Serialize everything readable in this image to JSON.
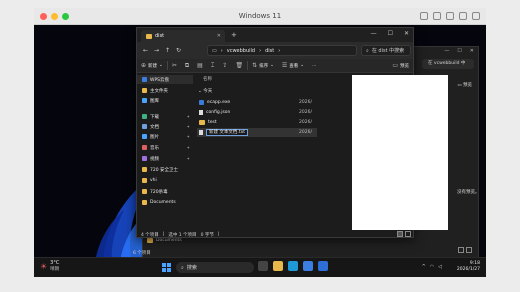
{
  "host": {
    "title": "Windows 11"
  },
  "bg_window": {
    "search_placeholder": "在 vcwebbuild 中",
    "preview_label": "预览",
    "message": "没有预览。",
    "nav_documents": "Documents",
    "status_count": "6 个项目"
  },
  "window": {
    "tab_title": "dist",
    "breadcrumb": [
      "vcwebbuild",
      "dist"
    ],
    "search_placeholder": "在 dist 中搜索",
    "cmd_new": "新建",
    "cmd_sort": "排序",
    "cmd_view": "查看",
    "cmd_more": "...",
    "cmd_preview": "预览"
  },
  "nav": {
    "items": [
      {
        "label": "WPS云盘",
        "color": "#3b7de0"
      },
      {
        "label": "主文件夹",
        "color": "#e8b84a"
      },
      {
        "label": "图库",
        "color": "#4aa3ff"
      },
      {
        "label": "下载",
        "color": "#3fb07f",
        "pinned": true
      },
      {
        "label": "文档",
        "color": "#6fa0e0",
        "pinned": true
      },
      {
        "label": "图片",
        "color": "#4aa3ff",
        "pinned": true
      },
      {
        "label": "音乐",
        "color": "#e06060",
        "pinned": true
      },
      {
        "label": "视频",
        "color": "#a070e0",
        "pinned": true
      },
      {
        "label": "720 安全卫士",
        "color": "#e8b84a"
      },
      {
        "label": "vhi",
        "color": "#e8b84a"
      },
      {
        "label": "720杀毒",
        "color": "#e8b84a"
      },
      {
        "label": "Documents",
        "color": "#e8b84a"
      }
    ]
  },
  "files": {
    "col_name": "名称",
    "col_date": "修改日期",
    "group_today": "今天",
    "rows": [
      {
        "name": "ecapp.exe",
        "date": "2026/",
        "icon": "exe"
      },
      {
        "name": "config.json",
        "date": "2026/",
        "icon": "doc"
      },
      {
        "name": "test",
        "date": "2026/",
        "icon": "folder"
      },
      {
        "name": "新建 文本文档.txt",
        "date": "2026/",
        "icon": "doc",
        "renaming": true
      }
    ]
  },
  "status": {
    "count": "4 个项目",
    "selection": "选中 1 个项目",
    "size": "0 字节"
  },
  "taskbar": {
    "weather_temp": "3°C",
    "weather_text": "晴朗",
    "search_label": "搜索",
    "clock_time": "9:18",
    "clock_date": "2026/1/27"
  },
  "colors": {
    "accent": "#4aa3ff",
    "folder": "#e8b84a",
    "rename_border": "#6fa0e0"
  }
}
